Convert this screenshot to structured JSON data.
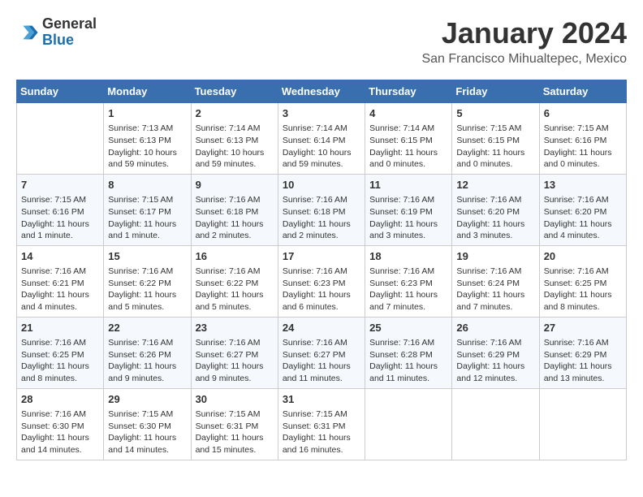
{
  "header": {
    "logo_general": "General",
    "logo_blue": "Blue",
    "month_title": "January 2024",
    "location": "San Francisco Mihualtepec, Mexico"
  },
  "weekdays": [
    "Sunday",
    "Monday",
    "Tuesday",
    "Wednesday",
    "Thursday",
    "Friday",
    "Saturday"
  ],
  "weeks": [
    [
      {
        "day": "",
        "info": ""
      },
      {
        "day": "1",
        "info": "Sunrise: 7:13 AM\nSunset: 6:13 PM\nDaylight: 10 hours\nand 59 minutes."
      },
      {
        "day": "2",
        "info": "Sunrise: 7:14 AM\nSunset: 6:13 PM\nDaylight: 10 hours\nand 59 minutes."
      },
      {
        "day": "3",
        "info": "Sunrise: 7:14 AM\nSunset: 6:14 PM\nDaylight: 10 hours\nand 59 minutes."
      },
      {
        "day": "4",
        "info": "Sunrise: 7:14 AM\nSunset: 6:15 PM\nDaylight: 11 hours\nand 0 minutes."
      },
      {
        "day": "5",
        "info": "Sunrise: 7:15 AM\nSunset: 6:15 PM\nDaylight: 11 hours\nand 0 minutes."
      },
      {
        "day": "6",
        "info": "Sunrise: 7:15 AM\nSunset: 6:16 PM\nDaylight: 11 hours\nand 0 minutes."
      }
    ],
    [
      {
        "day": "7",
        "info": "Sunrise: 7:15 AM\nSunset: 6:16 PM\nDaylight: 11 hours\nand 1 minute."
      },
      {
        "day": "8",
        "info": "Sunrise: 7:15 AM\nSunset: 6:17 PM\nDaylight: 11 hours\nand 1 minute."
      },
      {
        "day": "9",
        "info": "Sunrise: 7:16 AM\nSunset: 6:18 PM\nDaylight: 11 hours\nand 2 minutes."
      },
      {
        "day": "10",
        "info": "Sunrise: 7:16 AM\nSunset: 6:18 PM\nDaylight: 11 hours\nand 2 minutes."
      },
      {
        "day": "11",
        "info": "Sunrise: 7:16 AM\nSunset: 6:19 PM\nDaylight: 11 hours\nand 3 minutes."
      },
      {
        "day": "12",
        "info": "Sunrise: 7:16 AM\nSunset: 6:20 PM\nDaylight: 11 hours\nand 3 minutes."
      },
      {
        "day": "13",
        "info": "Sunrise: 7:16 AM\nSunset: 6:20 PM\nDaylight: 11 hours\nand 4 minutes."
      }
    ],
    [
      {
        "day": "14",
        "info": "Sunrise: 7:16 AM\nSunset: 6:21 PM\nDaylight: 11 hours\nand 4 minutes."
      },
      {
        "day": "15",
        "info": "Sunrise: 7:16 AM\nSunset: 6:22 PM\nDaylight: 11 hours\nand 5 minutes."
      },
      {
        "day": "16",
        "info": "Sunrise: 7:16 AM\nSunset: 6:22 PM\nDaylight: 11 hours\nand 5 minutes."
      },
      {
        "day": "17",
        "info": "Sunrise: 7:16 AM\nSunset: 6:23 PM\nDaylight: 11 hours\nand 6 minutes."
      },
      {
        "day": "18",
        "info": "Sunrise: 7:16 AM\nSunset: 6:23 PM\nDaylight: 11 hours\nand 7 minutes."
      },
      {
        "day": "19",
        "info": "Sunrise: 7:16 AM\nSunset: 6:24 PM\nDaylight: 11 hours\nand 7 minutes."
      },
      {
        "day": "20",
        "info": "Sunrise: 7:16 AM\nSunset: 6:25 PM\nDaylight: 11 hours\nand 8 minutes."
      }
    ],
    [
      {
        "day": "21",
        "info": "Sunrise: 7:16 AM\nSunset: 6:25 PM\nDaylight: 11 hours\nand 8 minutes."
      },
      {
        "day": "22",
        "info": "Sunrise: 7:16 AM\nSunset: 6:26 PM\nDaylight: 11 hours\nand 9 minutes."
      },
      {
        "day": "23",
        "info": "Sunrise: 7:16 AM\nSunset: 6:27 PM\nDaylight: 11 hours\nand 9 minutes."
      },
      {
        "day": "24",
        "info": "Sunrise: 7:16 AM\nSunset: 6:27 PM\nDaylight: 11 hours\nand 11 minutes."
      },
      {
        "day": "25",
        "info": "Sunrise: 7:16 AM\nSunset: 6:28 PM\nDaylight: 11 hours\nand 11 minutes."
      },
      {
        "day": "26",
        "info": "Sunrise: 7:16 AM\nSunset: 6:29 PM\nDaylight: 11 hours\nand 12 minutes."
      },
      {
        "day": "27",
        "info": "Sunrise: 7:16 AM\nSunset: 6:29 PM\nDaylight: 11 hours\nand 13 minutes."
      }
    ],
    [
      {
        "day": "28",
        "info": "Sunrise: 7:16 AM\nSunset: 6:30 PM\nDaylight: 11 hours\nand 14 minutes."
      },
      {
        "day": "29",
        "info": "Sunrise: 7:15 AM\nSunset: 6:30 PM\nDaylight: 11 hours\nand 14 minutes."
      },
      {
        "day": "30",
        "info": "Sunrise: 7:15 AM\nSunset: 6:31 PM\nDaylight: 11 hours\nand 15 minutes."
      },
      {
        "day": "31",
        "info": "Sunrise: 7:15 AM\nSunset: 6:31 PM\nDaylight: 11 hours\nand 16 minutes."
      },
      {
        "day": "",
        "info": ""
      },
      {
        "day": "",
        "info": ""
      },
      {
        "day": "",
        "info": ""
      }
    ]
  ]
}
